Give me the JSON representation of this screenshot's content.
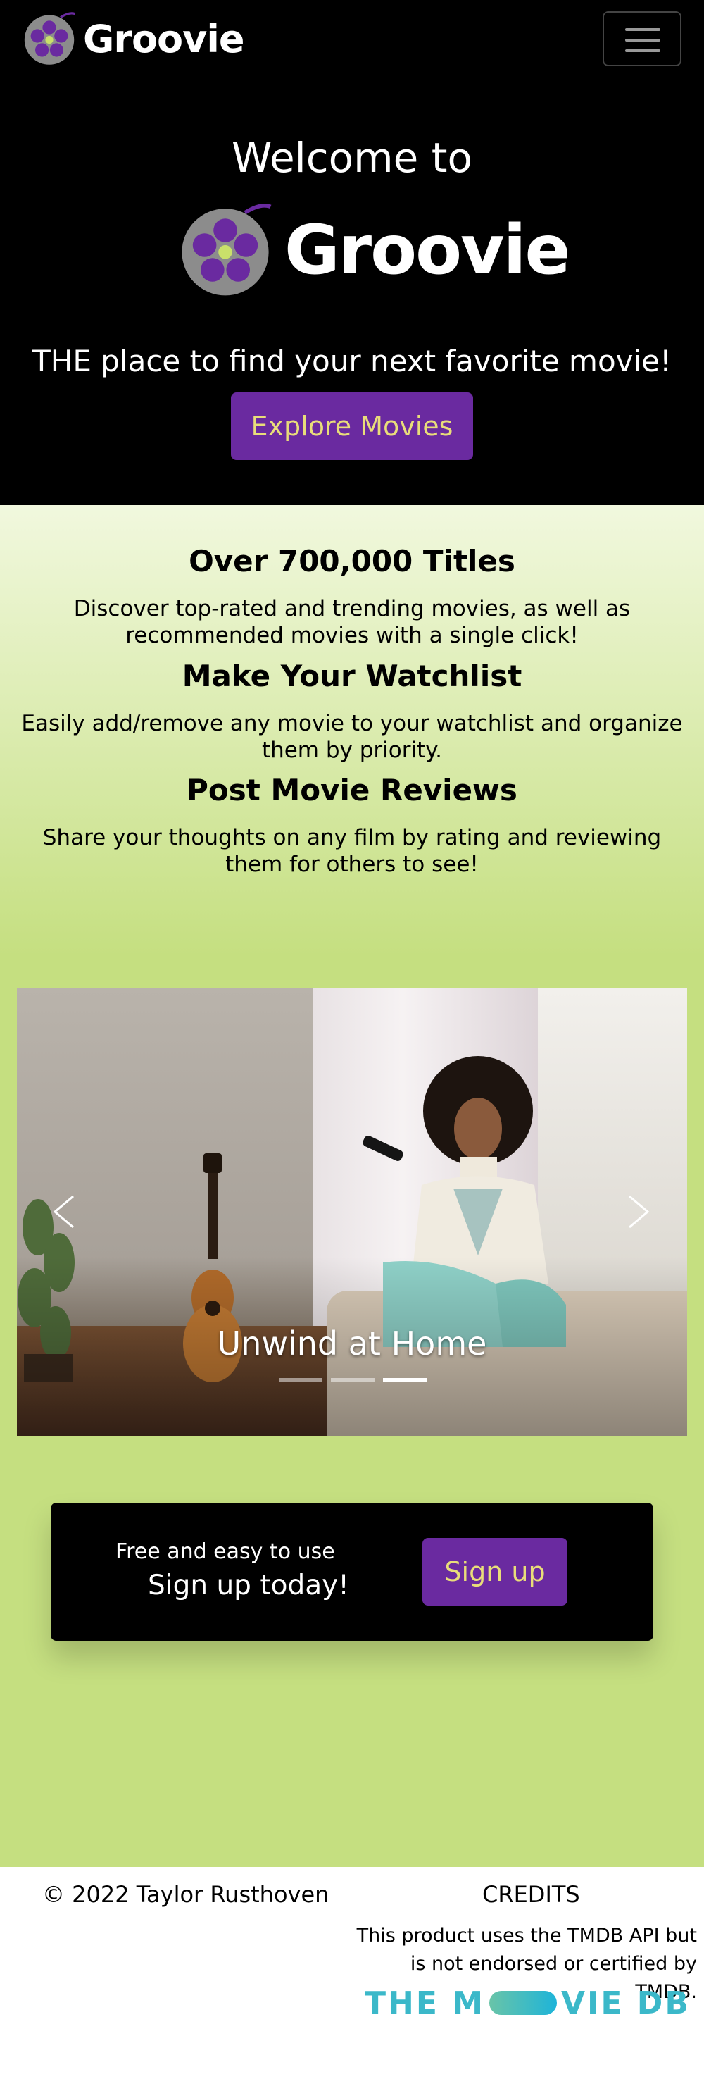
{
  "navbar": {
    "brand": "Groovie",
    "menu_icon": "hamburger-menu-icon"
  },
  "hero": {
    "welcome": "Welcome to",
    "brand": "Groovie",
    "tagline": "THE place to find your next favorite movie!",
    "cta_label": "Explore Movies"
  },
  "features": [
    {
      "title": "Over 700,000 Titles",
      "text": "Discover top-rated and trending movies, as well as recommended movies with a single click!"
    },
    {
      "title": "Make Your Watchlist",
      "text": "Easily add/remove any movie to your watchlist and organize them by priority."
    },
    {
      "title": "Post Movie Reviews",
      "text": "Share your thoughts on any film by rating and reviewing them for others to see!"
    }
  ],
  "carousel": {
    "caption": "Unwind at Home",
    "slide_count": 3,
    "active_index": 2,
    "prev_icon": "chevron-left-icon",
    "next_icon": "chevron-right-icon"
  },
  "signup": {
    "subtitle": "Free and easy to use",
    "title": "Sign up today!",
    "button_label": "Sign up"
  },
  "footer": {
    "copyright": "© 2022 Taylor Rusthoven",
    "credits_title": "CREDITS",
    "credits_text": "This product uses the TMDB API but is not endorsed or certified by TMDB.",
    "tmdb_logo_left": "THE M",
    "tmdb_logo_right": "VIE DB"
  },
  "colors": {
    "brand_purple": "#6a2aa0",
    "button_text": "#e9dd7a",
    "page_green": "#c5df80",
    "hero_bg": "#000000",
    "tmdb_teal": "#3bb8c9"
  }
}
